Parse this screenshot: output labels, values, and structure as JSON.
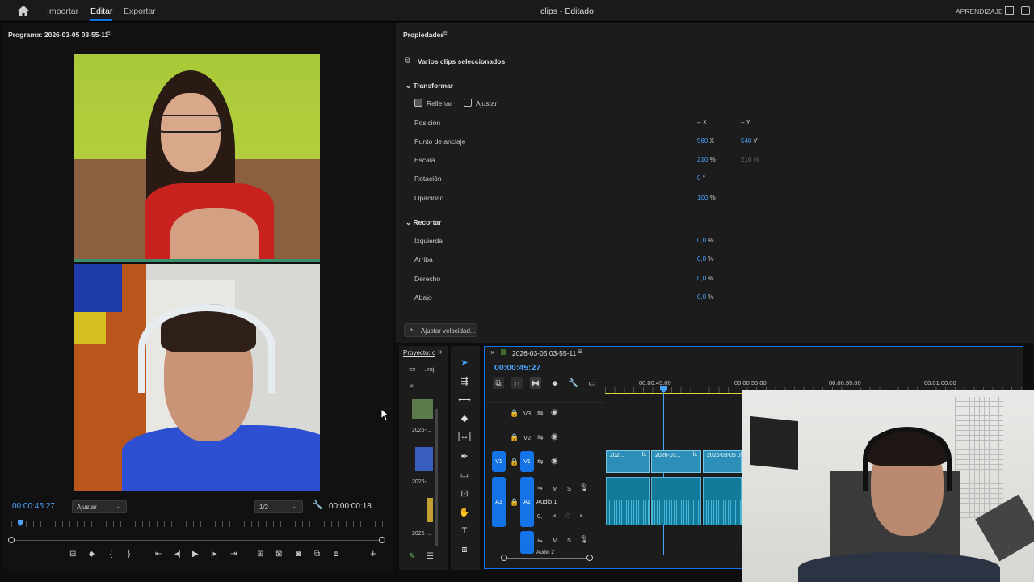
{
  "topbar": {
    "home_icon": "home-icon",
    "menu": [
      "Importar",
      "Editar",
      "Exportar"
    ],
    "title": "clips - Editado",
    "learning": "APRENDIZAJE"
  },
  "program": {
    "title": "Programa: 2026-03-05 03-55-11",
    "timecode": "00:00:45:27",
    "fit": "Ajustar",
    "resolution": "1/2",
    "duration": "00:00:00:18"
  },
  "properties": {
    "title": "Propiedades",
    "selection": "Varios clips seleccionados",
    "transform": {
      "heading": "Transformar",
      "fill": "Rellenar",
      "fit": "Ajustar",
      "rows": [
        {
          "label": "Posición",
          "v1": "– X",
          "v2": "– Y"
        },
        {
          "label": "Punto de anclaje",
          "v1": "960",
          "u1": "X",
          "v2": "540",
          "u2": "Y"
        },
        {
          "label": "Escala",
          "v1": "210",
          "u1": "%",
          "v2": "210 %"
        },
        {
          "label": "Rotación",
          "v1": "0",
          "u1": "°"
        },
        {
          "label": "Opacidad",
          "v1": "100",
          "u1": "%"
        }
      ]
    },
    "crop": {
      "heading": "Recortar",
      "rows": [
        {
          "label": "Izquierda",
          "v1": "0,0",
          "u1": "%"
        },
        {
          "label": "Arriba",
          "v1": "0,0",
          "u1": "%"
        },
        {
          "label": "Derecho",
          "v1": "0,0",
          "u1": "%"
        },
        {
          "label": "Abajo",
          "v1": "0,0",
          "u1": "%"
        }
      ]
    },
    "speed_button": "Ajustar velocidad..."
  },
  "project": {
    "title": "Proyecto: c",
    "bin": "..roj",
    "items": [
      "2026-...",
      "2026-...",
      "2026-..."
    ]
  },
  "timeline": {
    "sequence": "2026-03-05 03-55-11",
    "timecode": "00:00:45:27",
    "ruler": [
      "00:00:45:00",
      "00:00:50:00",
      "00:00:55:00",
      "00:01:00:00"
    ],
    "tracks": {
      "v3": "V3",
      "v2": "V2",
      "v1": "V1",
      "a1": "A1",
      "audio1": "Audio 1",
      "audio2": "Audio 2",
      "mute": "M",
      "solo": "S",
      "volume": "0,"
    },
    "clips": [
      "202...",
      "2026-03...",
      "2026-03-05 0"
    ]
  },
  "colors": {
    "accent": "#1473e6",
    "clip_video": "#2b8fb8",
    "clip_audio": "#137a9b",
    "playhead": "#4aa3ff"
  }
}
